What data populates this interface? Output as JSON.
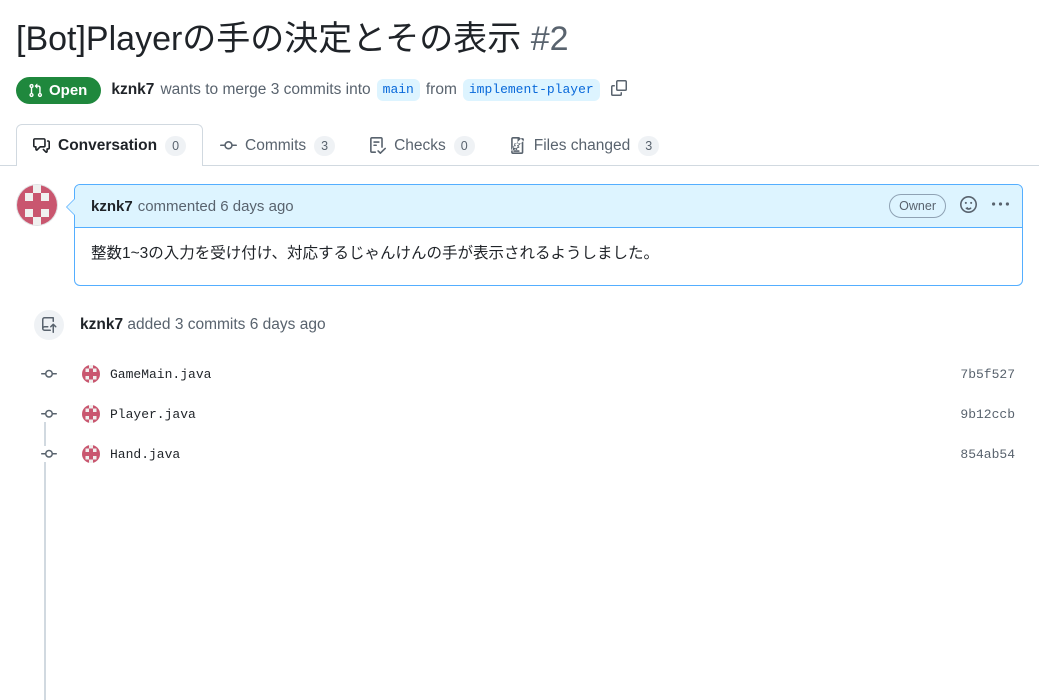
{
  "pr": {
    "title": "[Bot]Playerの手の決定とその表示",
    "number": "#2",
    "state_label": "Open",
    "merge_prefix_author": "kznk7",
    "merge_text_1": "wants to merge 3 commits into",
    "base_branch": "main",
    "merge_text_2": "from",
    "head_branch": "implement-player"
  },
  "tabs": [
    {
      "label": "Conversation",
      "count": "0",
      "icon": "comment-discussion-icon",
      "active": true
    },
    {
      "label": "Commits",
      "count": "3",
      "icon": "git-commit-icon",
      "active": false
    },
    {
      "label": "Checks",
      "count": "0",
      "icon": "checklist-icon",
      "active": false
    },
    {
      "label": "Files changed",
      "count": "3",
      "icon": "file-diff-icon",
      "active": false
    }
  ],
  "comment": {
    "author": "kznk7",
    "meta": "commented 6 days ago",
    "role_badge": "Owner",
    "body": "整数1~3の入力を受け付け、対応するじゃんけんの手が表示されるようしました。"
  },
  "commits_event": {
    "author": "kznk7",
    "text": "added 3 commits 6 days ago"
  },
  "commits": [
    {
      "message": "GameMain.java",
      "sha": "7b5f527"
    },
    {
      "message": "Player.java",
      "sha": "9b12ccb"
    },
    {
      "message": "Hand.java",
      "sha": "854ab54"
    }
  ],
  "colors": {
    "open_green": "#1f883d",
    "branch_chip_bg": "#ddf4ff",
    "branch_chip_text": "#0969da",
    "comment_head_bg": "#ddf4ff",
    "comment_border": "#54aeff",
    "avatar_pink": "#c9566f",
    "border_gray": "#d1d9e0",
    "muted_text": "#59636e"
  }
}
